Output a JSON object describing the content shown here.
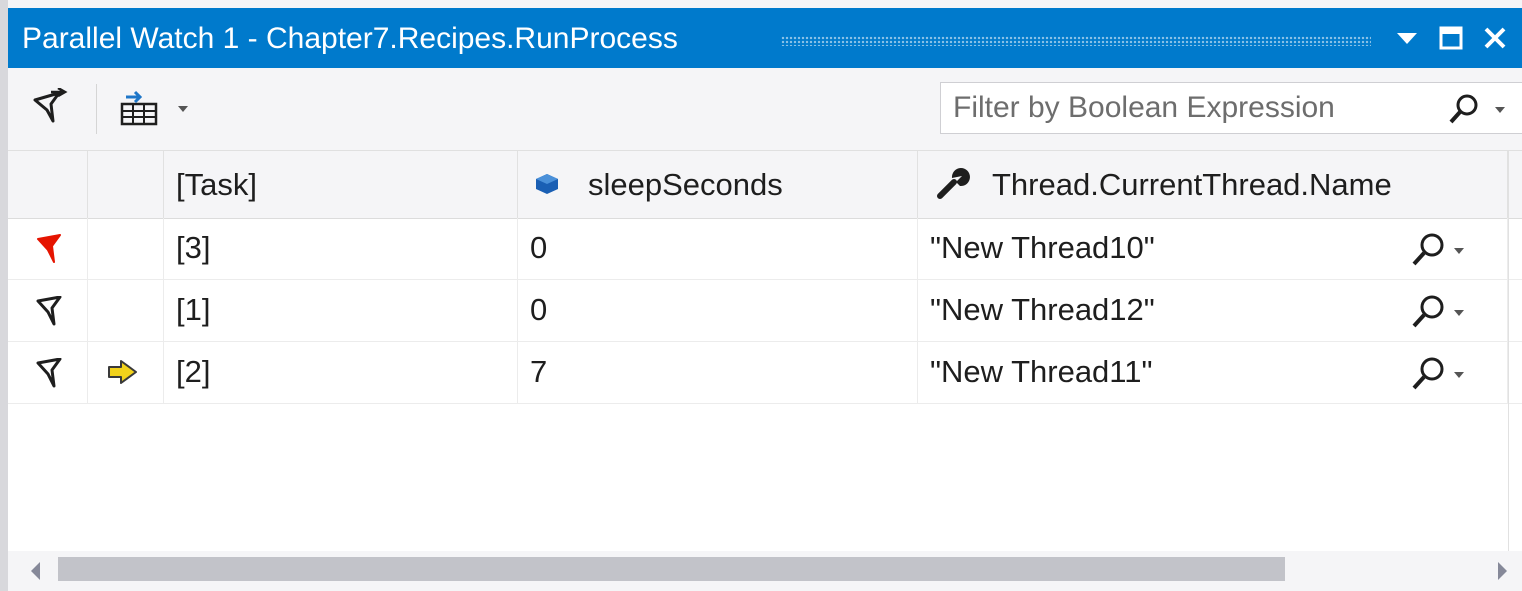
{
  "window": {
    "title": "Parallel Watch 1 - Chapter7.Recipes.RunProcess",
    "titlebar_color": "#007acc",
    "buttons": [
      {
        "name": "dropdown-button",
        "icon": "caret-down-icon"
      },
      {
        "name": "maximize-button",
        "icon": "maximize-icon"
      },
      {
        "name": "close-button",
        "icon": "close-icon"
      }
    ]
  },
  "toolbar": {
    "flag_tool_icon": "flag-filter-icon",
    "columns_tool_icon": "add-watch-columns-icon",
    "filter": {
      "placeholder": "Filter by Boolean Expression",
      "value": "",
      "search_icon": "search-icon"
    }
  },
  "grid": {
    "columns": [
      "",
      "",
      "[Task]",
      "sleepSeconds",
      "Thread.CurrentThread.Name"
    ],
    "column_icons": {
      "sleepSeconds": "variable-icon",
      "Thread.CurrentThread.Name": "property-wrench-icon"
    },
    "rows": [
      {
        "flag": "flagged",
        "current": false,
        "task": "[3]",
        "sleepSeconds": "0",
        "threadName": "\"New Thread10\""
      },
      {
        "flag": "unflagged",
        "current": false,
        "task": "[1]",
        "sleepSeconds": "0",
        "threadName": "\"New Thread12\""
      },
      {
        "flag": "unflagged",
        "current": true,
        "task": "[2]",
        "sleepSeconds": "7",
        "threadName": "\"New Thread11\""
      }
    ],
    "colors": {
      "flagged": "#e51400",
      "current_arrow": "#f2d21b"
    }
  },
  "scrollbar": {
    "position": 0.0,
    "visible_fraction": 0.81
  }
}
